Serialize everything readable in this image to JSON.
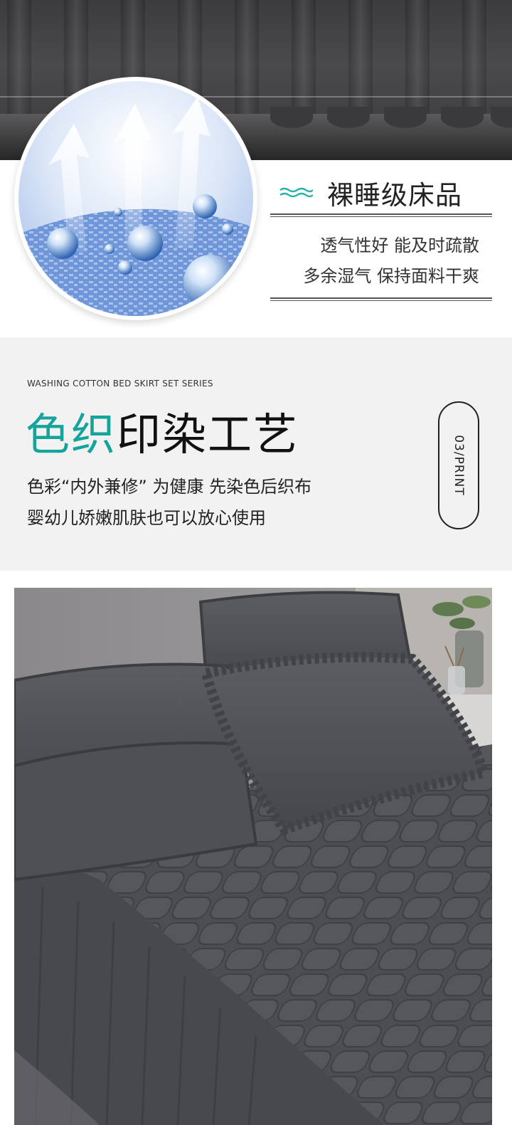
{
  "feature": {
    "title": "裸睡级床品",
    "desc_line1": "透气性好 能及时疏散",
    "desc_line2": "多余湿气 保持面料干爽",
    "icons": [
      "wave-icon",
      "airflow-arrow-icon",
      "water-droplet-icon"
    ],
    "accent_color": "#2bb3a9"
  },
  "process": {
    "series": "WASHING COTTON BED SKIRT SET SERIES",
    "headline_accent": "色织",
    "headline_rest": "印染工艺",
    "desc_line1": "色彩“内外兼修” 为健康 先染色后织布",
    "desc_line2": "婴幼儿娇嫩肌肤也可以放心使用",
    "badge": "03/PRINT",
    "accent_color": "#14a49b"
  },
  "colors": {
    "fabric": "#4b4c50",
    "panel_background": "#f2f2f2"
  }
}
